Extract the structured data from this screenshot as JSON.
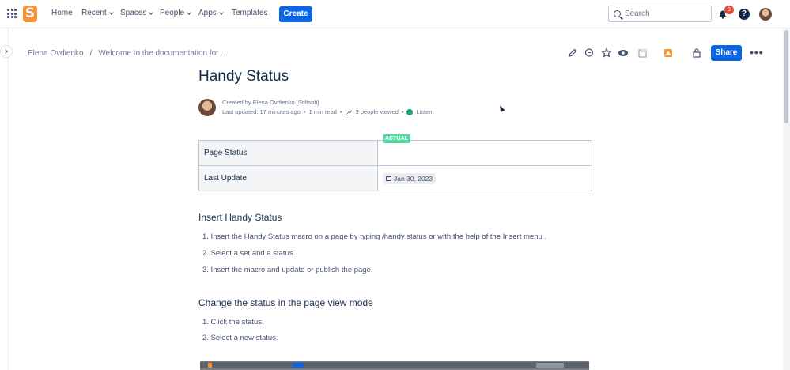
{
  "topnav": {
    "logo_letter": "S",
    "items": [
      {
        "label": "Home"
      },
      {
        "label": "Recent"
      },
      {
        "label": "Spaces"
      },
      {
        "label": "People"
      },
      {
        "label": "Apps"
      },
      {
        "label": "Templates"
      }
    ],
    "create_label": "Create",
    "search_placeholder": "Search",
    "notifications_count": "9",
    "help_label": "?"
  },
  "breadcrumb": {
    "items": [
      "Elena Ovdienko",
      "/",
      "Welcome to the documentation for ..."
    ]
  },
  "page_actions": {
    "share_label": "Share",
    "more_label": "•••"
  },
  "page": {
    "title": "Handy Status",
    "created_by": "Created by Elena Ovdienko [Stiltsoft]",
    "last_updated": "Last updated: 17 minutes ago",
    "read_time": "1 min read",
    "viewed": "3 people viewed",
    "listen": "Listen",
    "sep": "•"
  },
  "table": {
    "rows": [
      {
        "label": "Page Status",
        "value": "ACTUAL"
      },
      {
        "label": "Last Update",
        "value": "Jan 30, 2023"
      }
    ]
  },
  "sections": [
    {
      "heading": "Insert Handy Status",
      "items": [
        "1. Insert the Handy Status macro on a page by typing /handy status or with the help of the Insert menu .",
        "2. Select a set and a status.",
        "3. Insert the macro and update or publish the page."
      ]
    },
    {
      "heading": "Change the status in the page view mode",
      "items": [
        "1. Click the status.",
        "2. Select a new status."
      ]
    }
  ],
  "colors": {
    "primary": "#0c66e4",
    "logo": "#f79232",
    "status_lozenge": "#57d9a3",
    "badge": "#e34935"
  }
}
